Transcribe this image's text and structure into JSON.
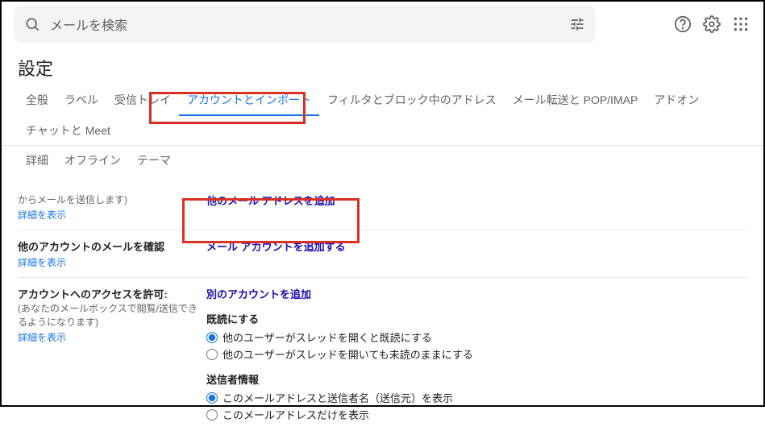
{
  "search": {
    "placeholder": "メールを検索"
  },
  "settings_title": "設定",
  "tabs": {
    "general": "全般",
    "labels": "ラベル",
    "inbox": "受信トレイ",
    "accounts": "アカウントとインポート",
    "filters": "フィルタとブロック中のアドレス",
    "forwarding": "メール転送と POP/IMAP",
    "addons": "アドオン",
    "chat": "チャットと Meet",
    "advanced": "詳細",
    "offline": "オフライン",
    "themes": "テーマ"
  },
  "section1": {
    "sub": "からメールを送信します)",
    "learn": "詳細を表示",
    "action": "他のメール アドレスを追加"
  },
  "section2": {
    "label": "他のアカウントのメールを確認",
    "learn": "詳細を表示",
    "action": "メール アカウントを追加する"
  },
  "section3": {
    "label": "アカウントへのアクセスを許可:",
    "sub": "(あなたのメールボックスで閲覧/送信できるようになります)",
    "learn": "詳細を表示",
    "action": "別のアカウントを追加",
    "read_title": "既読にする",
    "read_opt1": "他のユーザーがスレッドを開くと既読にする",
    "read_opt2": "他のユーザーがスレッドを開いても未読のままにする",
    "sender_title": "送信者情報",
    "sender_opt1": "このメールアドレスと送信者名（送信元）を表示",
    "sender_opt2": "このメールアドレスだけを表示"
  }
}
